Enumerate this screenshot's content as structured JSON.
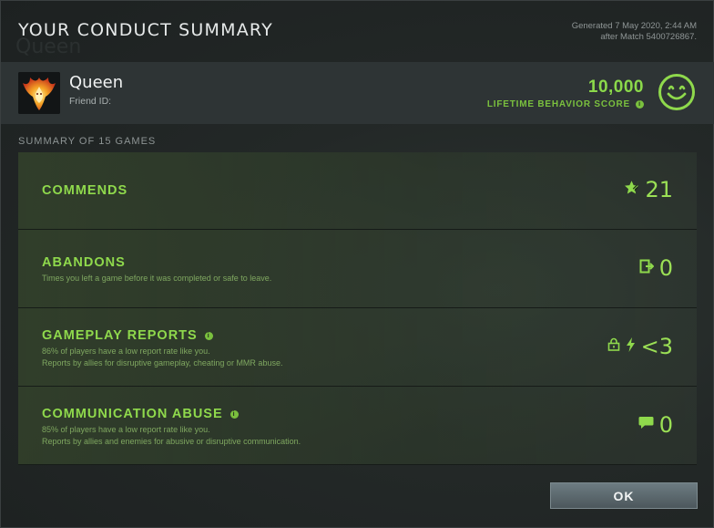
{
  "dialog": {
    "title": "YOUR CONDUCT SUMMARY",
    "generated_line1": "Generated 7 May 2020, 2:44 AM",
    "generated_line2": "after Match 5400726867.",
    "ghost_text": "Queen"
  },
  "player": {
    "name": "Queen",
    "friend_id_label": "Friend ID:",
    "avatar_icon": "phoenix-emblem-icon",
    "lifetime_score": "10,000",
    "lifetime_score_label": "LIFETIME BEHAVIOR SCORE",
    "score_info_icon": "info-icon",
    "mood_icon": "smiley-face-icon"
  },
  "summary": {
    "heading": "SUMMARY OF 15 GAMES",
    "rows": [
      {
        "title": "COMMENDS",
        "desc1": "",
        "desc2": "",
        "icons": [
          "star-icon"
        ],
        "value": "21"
      },
      {
        "title": "ABANDONS",
        "desc1": "Times you left a game before it was completed or safe to leave.",
        "desc2": "",
        "icons": [
          "exit-door-icon"
        ],
        "value": "0"
      },
      {
        "title": "GAMEPLAY REPORTS",
        "desc1": "86% of players have a low report rate like you.",
        "desc2": "Reports by allies for disruptive gameplay, cheating or MMR abuse.",
        "icons": [
          "lock-icon",
          "lightning-icon"
        ],
        "value": "<3"
      },
      {
        "title": "COMMUNICATION ABUSE",
        "desc1": "85% of players have a low report rate like you.",
        "desc2": "Reports by allies and enemies for abusive or disruptive communication.",
        "icons": [
          "chat-bubble-icon"
        ],
        "value": "0"
      }
    ]
  },
  "footer": {
    "ok_label": "OK"
  },
  "colors": {
    "accent_green": "#8fd94c",
    "background": "#1c1f20",
    "button": "#5c6a70"
  }
}
